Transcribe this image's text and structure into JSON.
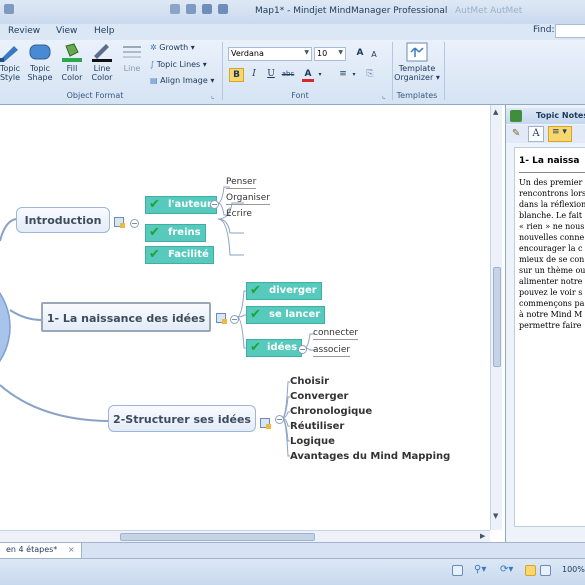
{
  "window": {
    "title": "Map1* - Mindjet MindManager Professional",
    "ghost_title": "AutMet AutMet"
  },
  "menu": {
    "items": [
      "Review",
      "View",
      "Help"
    ],
    "find_label": "Find:"
  },
  "ribbon": {
    "object_format": {
      "label": "Object Format",
      "topic_style_label": "Topic Style",
      "topic_shape_label": "Topic Shape",
      "fill_color_label": "Fill Color",
      "line_color_label": "Line Color",
      "line_label": "Line",
      "growth_label": "Growth",
      "topic_lines_label": "Topic Lines",
      "align_image_label": "Align Image"
    },
    "font": {
      "label": "Font",
      "family": "Verdana",
      "size": "10",
      "bold": "B",
      "italic": "I",
      "underline": "U",
      "strike": "abc",
      "color": "A",
      "grow": "A",
      "shrink": "A"
    },
    "templates": {
      "label": "Templates",
      "template_organizer_label": "Template Organizer"
    }
  },
  "map": {
    "topics": [
      {
        "id": "introduction",
        "label": "Introduction"
      },
      {
        "id": "naissance",
        "label": "1- La naissance des idées"
      },
      {
        "id": "structurer",
        "label": "2-Structurer ses idées"
      }
    ],
    "intro_tasks": [
      "l'auteur",
      "freins",
      "Facilité"
    ],
    "intro_leaves": [
      "Penser",
      "Organiser",
      "Écrire"
    ],
    "naissance_tasks": [
      "diverger",
      "se lancer",
      "idées"
    ],
    "naissance_leaves": [
      "connecter",
      "associer"
    ],
    "structurer_items": [
      "Choisir",
      "Converger",
      "Chronologique",
      "Réutiliser",
      "Logique",
      "Avantages du Mind Mapping"
    ],
    "colors": {
      "task_fill": "#57c9bd",
      "check": "#1fa52d",
      "topic_border": "#9fb6d6",
      "connector": "#8aa2c4"
    }
  },
  "notes_panel": {
    "header": "Topic Notes",
    "title": "1- La naissa",
    "lines": [
      "Un des premier",
      "rencontrons lors",
      "dans la réflexion",
      "blanche. Le fait",
      "« rien » ne nous",
      "nouvelles conne",
      "encourager la c",
      "mieux de se con",
      "sur un thème ou",
      "alimenter notre",
      "pouvez le voir s",
      "commençons pa",
      "à notre Mind M",
      "permettre faire"
    ]
  },
  "tabs": {
    "active": "en 4 étapes*",
    "close": "×"
  },
  "status": {
    "zoom": "100%"
  }
}
